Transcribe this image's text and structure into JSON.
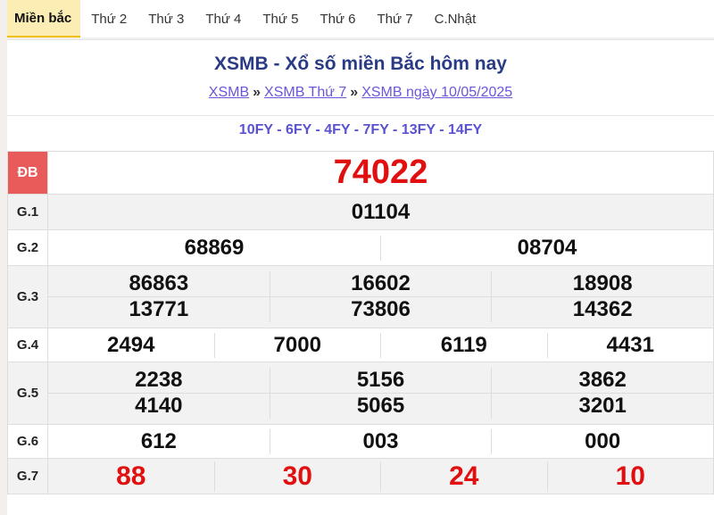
{
  "tabs": [
    "Miền bắc",
    "Thứ 2",
    "Thứ 3",
    "Thứ 4",
    "Thứ 5",
    "Thứ 6",
    "Thứ 7",
    "C.Nhật"
  ],
  "title": "XSMB - Xổ số miền Bắc hôm nay",
  "breadcrumb": [
    "XSMB",
    "XSMB Thứ 7",
    "XSMB ngày 10/05/2025"
  ],
  "breadcrumb_sep": "»",
  "codes": "10FY - 6FY - 4FY - 7FY - 13FY - 14FY",
  "labels": {
    "db": "ĐB",
    "g1": "G.1",
    "g2": "G.2",
    "g3": "G.3",
    "g4": "G.4",
    "g5": "G.5",
    "g6": "G.6",
    "g7": "G.7"
  },
  "prizes": {
    "db": "74022",
    "g1": "01104",
    "g2": [
      "68869",
      "08704"
    ],
    "g3": [
      "86863",
      "16602",
      "18908",
      "13771",
      "73806",
      "14362"
    ],
    "g4": [
      "2494",
      "7000",
      "6119",
      "4431"
    ],
    "g5": [
      "2238",
      "5156",
      "3862",
      "4140",
      "5065",
      "3201"
    ],
    "g6": [
      "612",
      "003",
      "000"
    ],
    "g7": [
      "88",
      "30",
      "24",
      "10"
    ]
  },
  "colors": {
    "accent_red": "#e01010",
    "title_blue": "#2a3b85",
    "active_tab": "#fcedb4"
  }
}
